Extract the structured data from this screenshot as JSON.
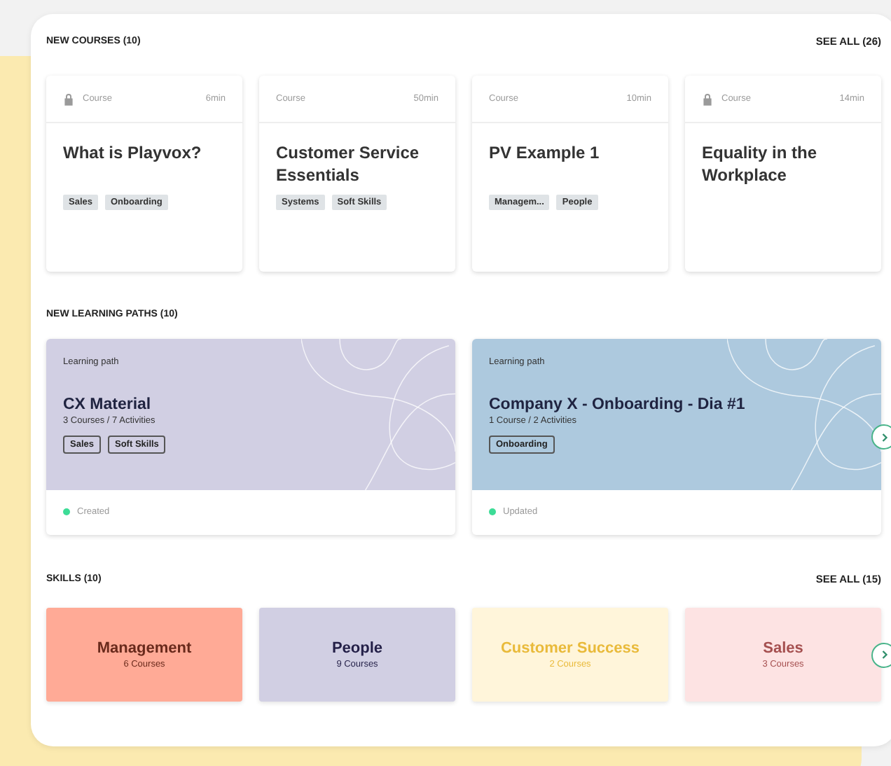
{
  "new_courses": {
    "title": "NEW COURSES (10)",
    "see_all": "SEE ALL (26)",
    "items": [
      {
        "type": "Course",
        "duration": "6min",
        "locked": true,
        "title": "What is Playvox?",
        "tags": [
          "Sales",
          "Onboarding"
        ]
      },
      {
        "type": "Course",
        "duration": "50min",
        "locked": false,
        "title": "Customer Service Essentials",
        "tags": [
          "Systems",
          "Soft Skills"
        ]
      },
      {
        "type": "Course",
        "duration": "10min",
        "locked": false,
        "title": "PV Example 1",
        "tags": [
          "Managem...",
          "People"
        ]
      },
      {
        "type": "Course",
        "duration": "14min",
        "locked": true,
        "title": "Equality in the Workplace"
      }
    ]
  },
  "learning_paths": {
    "title": "NEW LEARNING PATHS (10)",
    "items": [
      {
        "label": "Learning path",
        "title": "CX Material",
        "summary": "3 Courses / 7 Activities",
        "tags": [
          "Sales",
          "Soft Skills"
        ],
        "color": "#d1cfe3",
        "status": "Created"
      },
      {
        "label": "Learning path",
        "title": "Company X - Onboarding - Dia #1",
        "summary": "1 Course / 2 Activities",
        "tags": [
          "Onboarding"
        ],
        "color": "#adc9de",
        "status": "Updated"
      }
    ]
  },
  "skills": {
    "title": "SKILLS (10)",
    "see_all": "SEE ALL (15)",
    "items": [
      {
        "name": "Management",
        "count": "6 Courses",
        "color": "#ffaa96"
      },
      {
        "name": "People",
        "count": "9 Courses",
        "color": "#d1cfe3"
      },
      {
        "name": "Customer Success",
        "count": "2 Courses",
        "color": "#fff5da"
      },
      {
        "name": "Sales",
        "count": "3 Courses",
        "color": "#fde3e3"
      }
    ]
  }
}
